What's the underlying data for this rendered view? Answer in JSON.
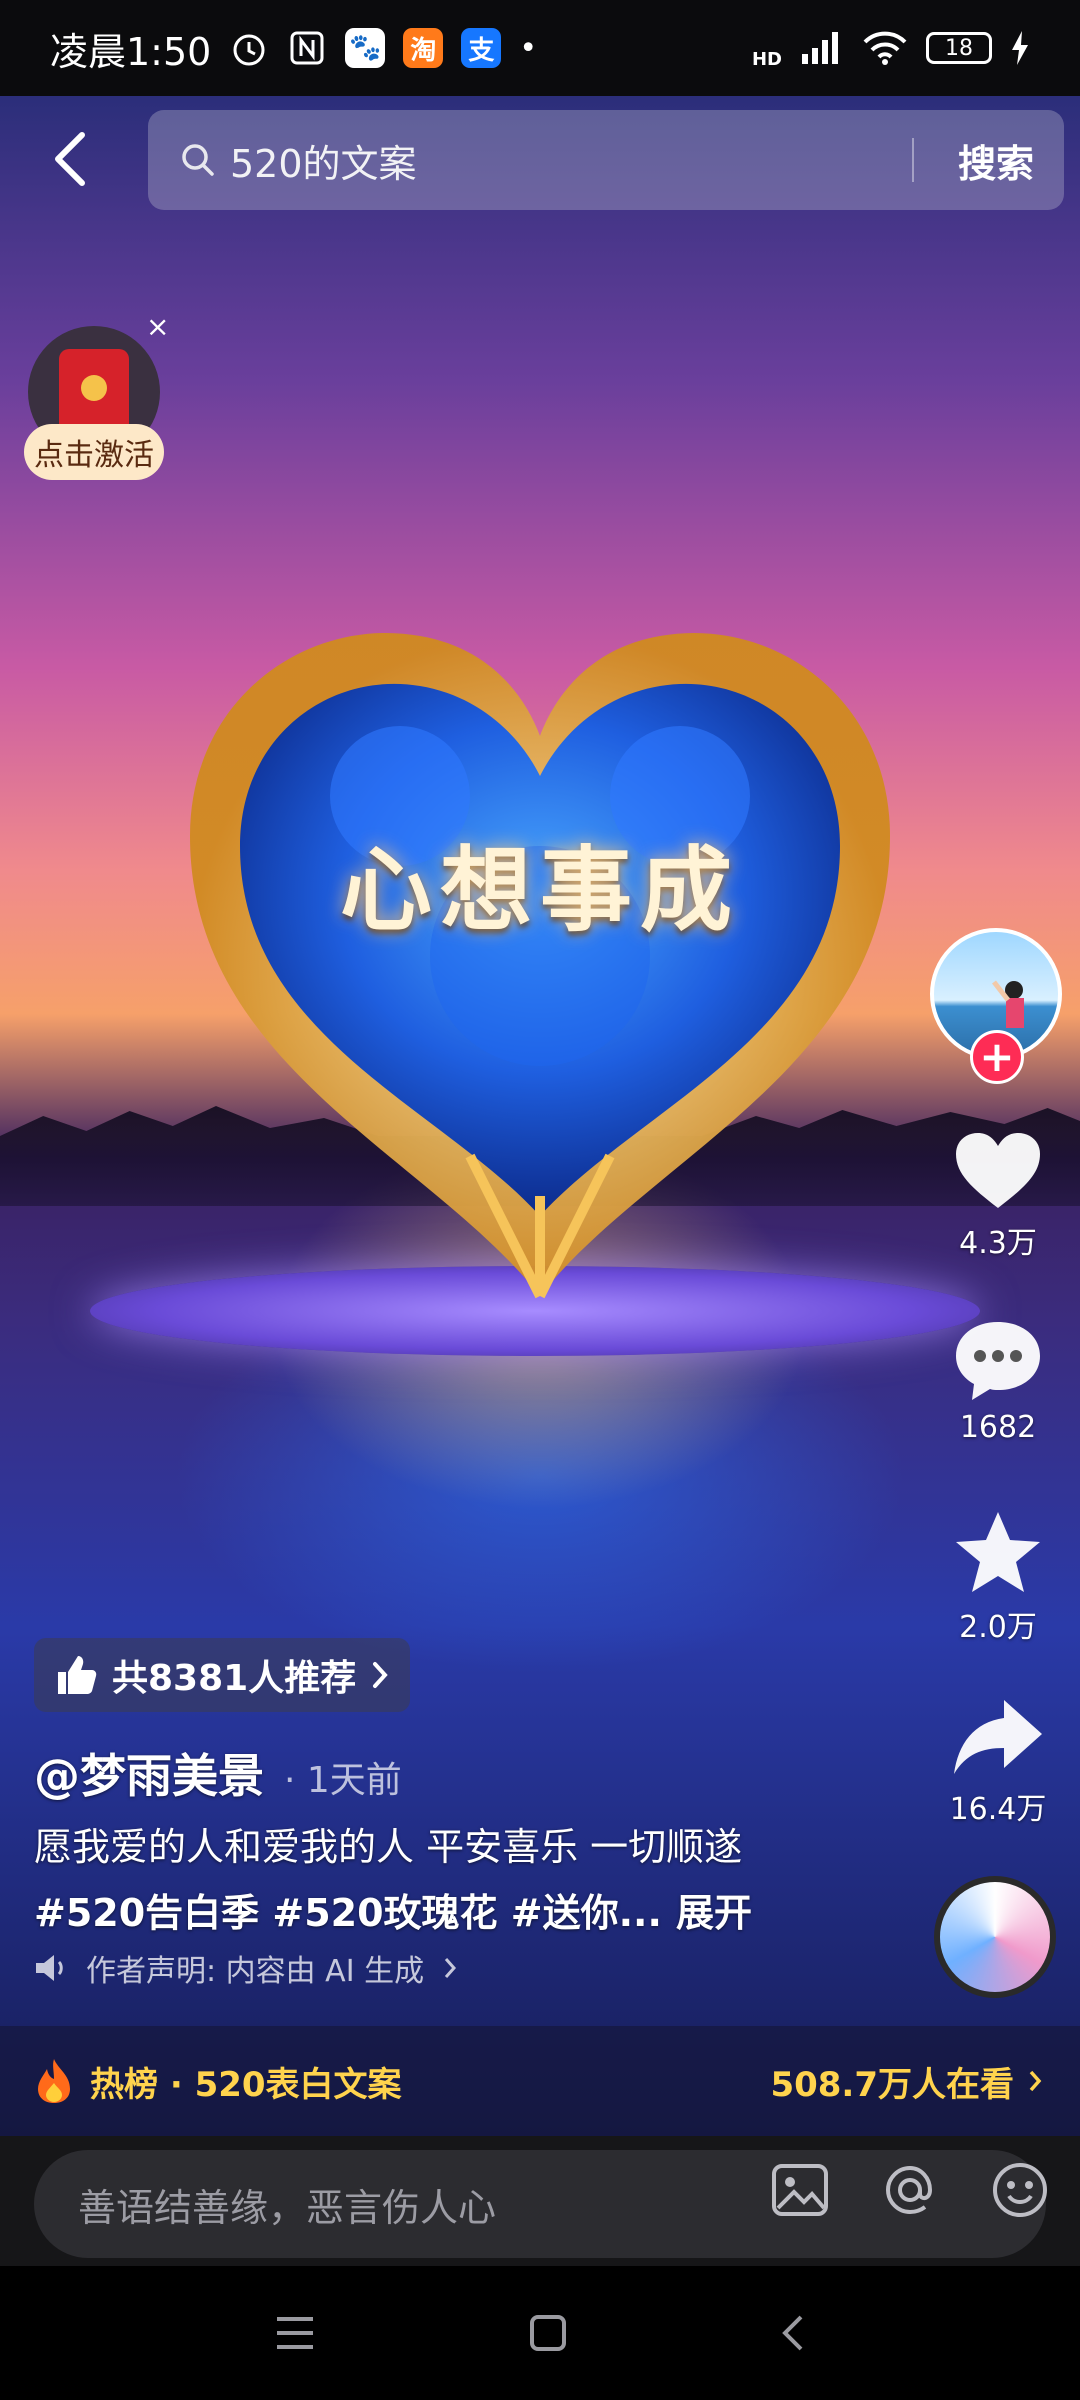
{
  "status_bar": {
    "time": "凌晨1:50",
    "battery": "18",
    "network": "HD"
  },
  "search": {
    "query": "520的文案",
    "button_label": "搜索"
  },
  "redpacket": {
    "label": "点击激活",
    "close": "×"
  },
  "video": {
    "overlay_title": "心想事成"
  },
  "actions": {
    "likes": "4.3万",
    "comments": "1682",
    "favorites": "2.0万",
    "shares": "16.4万"
  },
  "post": {
    "recommend": "共8381人推荐",
    "author": "@梦雨美景",
    "time": "· 1天前",
    "description": "愿我爱的人和爱我的人 平安喜乐 一切顺遂",
    "tags": "#520告白季 #520玫瑰花 #送你...",
    "expand": "展开",
    "declaration": "作者声明: 内容由 AI 生成"
  },
  "hot": {
    "title": "热榜 · 520表白文案",
    "watching": "508.7万人在看"
  },
  "comment": {
    "placeholder": "善语结善缘，恶言伤人心"
  },
  "colors": {
    "accent_red": "#fe2c55",
    "hot_yellow": "#ffd34d"
  }
}
